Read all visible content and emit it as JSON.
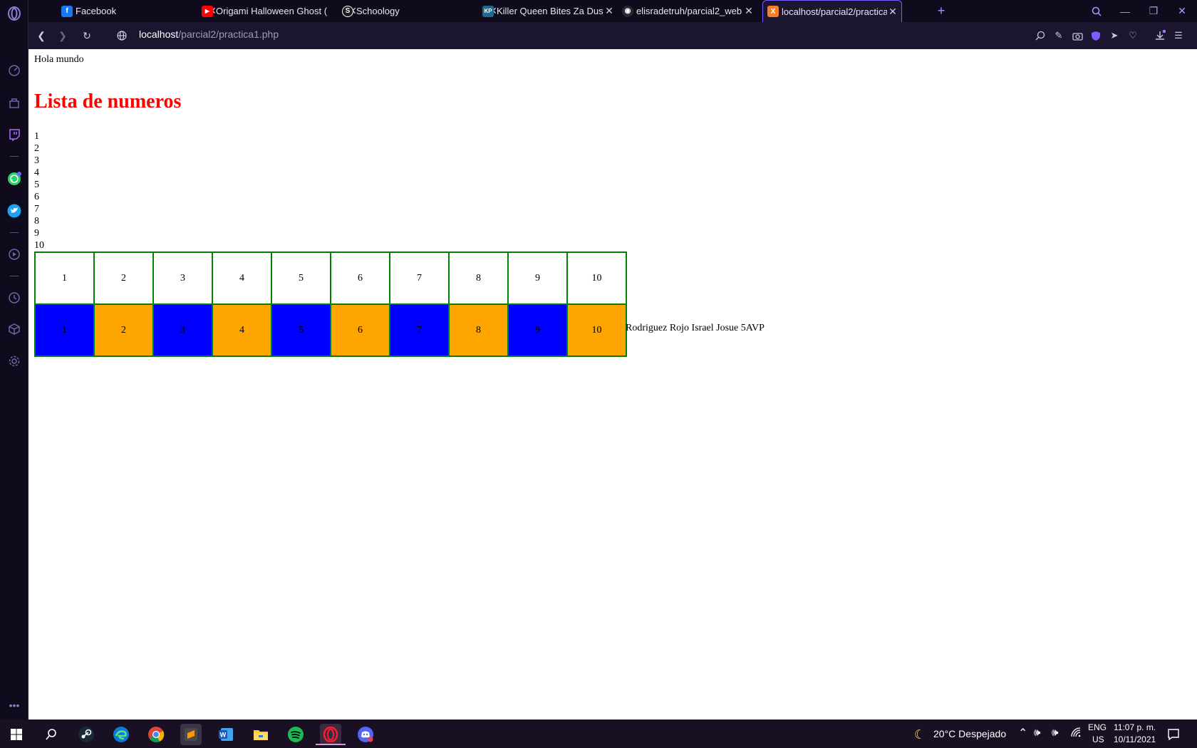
{
  "browser": {
    "tabs": [
      {
        "title": "Facebook",
        "favicon": "facebook-icon",
        "color": "#1877f2",
        "glyph": "f"
      },
      {
        "title": "Origami Halloween Ghost (",
        "favicon": "youtube-icon",
        "color": "#ff0000",
        "glyph": "▶"
      },
      {
        "title": "Schoology",
        "favicon": "schoology-icon",
        "color": "#1a1a1a",
        "glyph": "S"
      },
      {
        "title": "Killer Queen Bites Za Dusto",
        "favicon": "kp-icon",
        "color": "#1f6b8f",
        "glyph": "KP"
      },
      {
        "title": "elisradetruh/parcial2_web",
        "favicon": "github-icon",
        "color": "#24292e",
        "glyph": "◉"
      },
      {
        "title": "localhost/parcial2/practica",
        "favicon": "xampp-icon",
        "color": "#fb7a24",
        "glyph": "X"
      }
    ],
    "address": {
      "host": "localhost",
      "path": "/parcial2/practica1.php"
    }
  },
  "page": {
    "hello": "Hola mundo",
    "heading": "Lista de numeros",
    "numbers": [
      "1",
      "2",
      "3",
      "4",
      "5",
      "6",
      "7",
      "8",
      "9",
      "10"
    ],
    "table_row1": [
      "1",
      "2",
      "3",
      "4",
      "5",
      "6",
      "7",
      "8",
      "9",
      "10"
    ],
    "table_row2": [
      "1",
      "2",
      "3",
      "4",
      "5",
      "6",
      "7",
      "8",
      "9",
      "10"
    ],
    "signature": "Rodriguez Rojo Israel Josue 5AVP",
    "colors": {
      "odd": "#0000ff",
      "even": "#ffa500",
      "border": "#008000",
      "heading": "#ff0000"
    }
  },
  "taskbar": {
    "weather": "20°C  Despejado",
    "lang_top": "ENG",
    "lang_bottom": "US",
    "time": "11:07 p. m.",
    "date": "10/11/2021"
  }
}
